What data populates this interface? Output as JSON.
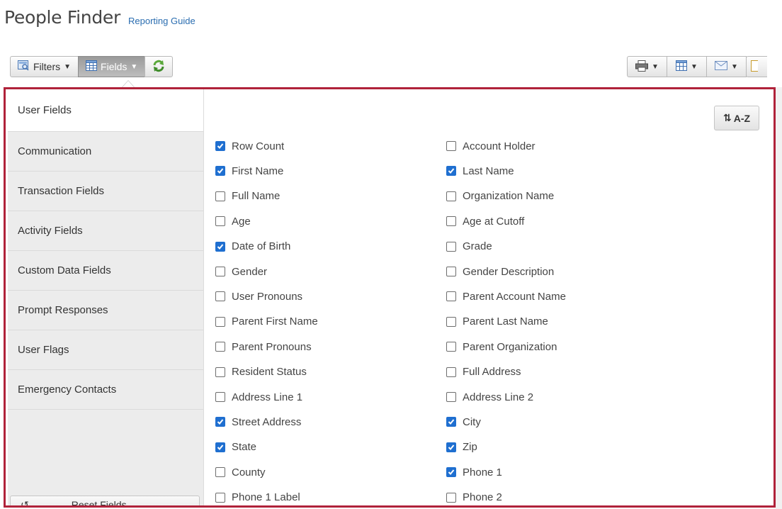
{
  "page": {
    "title": "People Finder",
    "guide_link": "Reporting Guide"
  },
  "toolbar": {
    "filters_label": "Filters",
    "fields_label": "Fields",
    "refresh_icon": "refresh-icon",
    "print_icon": "printer-icon",
    "table_icon": "table-icon",
    "email_icon": "envelope-icon"
  },
  "sidebar": {
    "items": [
      {
        "label": "User Fields",
        "active": true
      },
      {
        "label": "Communication"
      },
      {
        "label": "Transaction Fields"
      },
      {
        "label": "Activity Fields"
      },
      {
        "label": "Custom Data Fields"
      },
      {
        "label": "Prompt Responses"
      },
      {
        "label": "User Flags"
      },
      {
        "label": "Emergency Contacts"
      }
    ],
    "reset_label": "Reset Fields"
  },
  "sort_button": {
    "label": "A-Z"
  },
  "fields_left": [
    {
      "label": "Row Count",
      "checked": true
    },
    {
      "label": "First Name",
      "checked": true
    },
    {
      "label": "Full Name",
      "checked": false
    },
    {
      "label": "Age",
      "checked": false
    },
    {
      "label": "Date of Birth",
      "checked": true
    },
    {
      "label": "Gender",
      "checked": false
    },
    {
      "label": "User Pronouns",
      "checked": false
    },
    {
      "label": "Parent First Name",
      "checked": false
    },
    {
      "label": "Parent Pronouns",
      "checked": false
    },
    {
      "label": "Resident Status",
      "checked": false
    },
    {
      "label": "Address Line 1",
      "checked": false
    },
    {
      "label": "Street Address",
      "checked": true
    },
    {
      "label": "State",
      "checked": true
    },
    {
      "label": "County",
      "checked": false
    },
    {
      "label": "Phone 1 Label",
      "checked": false
    }
  ],
  "fields_right": [
    {
      "label": "Account Holder",
      "checked": false
    },
    {
      "label": "Last Name",
      "checked": true
    },
    {
      "label": "Organization Name",
      "checked": false
    },
    {
      "label": "Age at Cutoff",
      "checked": false
    },
    {
      "label": "Grade",
      "checked": false
    },
    {
      "label": "Gender Description",
      "checked": false
    },
    {
      "label": "Parent Account Name",
      "checked": false
    },
    {
      "label": "Parent Last Name",
      "checked": false
    },
    {
      "label": "Parent Organization",
      "checked": false
    },
    {
      "label": "Full Address",
      "checked": false
    },
    {
      "label": "Address Line 2",
      "checked": false
    },
    {
      "label": "City",
      "checked": true
    },
    {
      "label": "Zip",
      "checked": true
    },
    {
      "label": "Phone 1",
      "checked": true
    },
    {
      "label": "Phone 2",
      "checked": false
    }
  ],
  "colors": {
    "accent_border": "#b0223a",
    "checkbox_on": "#1f6fd0"
  }
}
